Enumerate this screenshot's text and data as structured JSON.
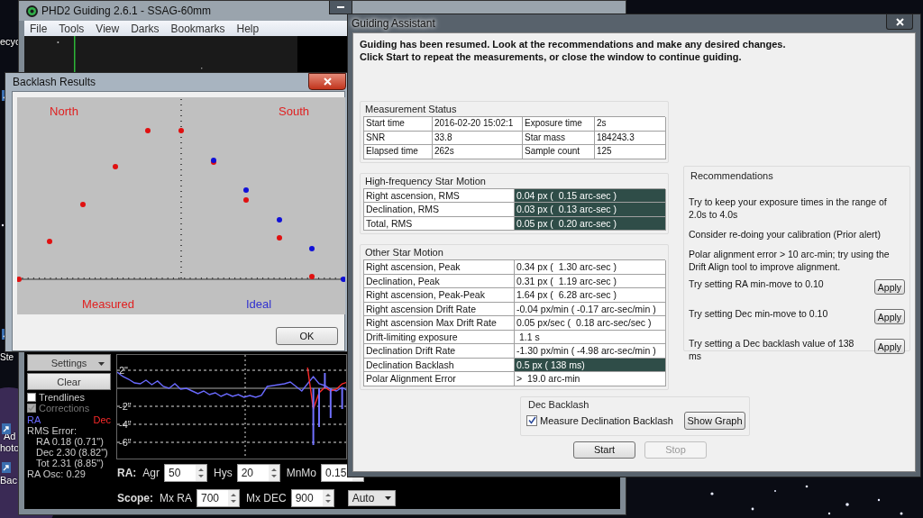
{
  "desktop": {
    "icon_labels": [
      "ecyc",
      "Ste",
      "Ad",
      "hoto",
      "Bac"
    ]
  },
  "main_window": {
    "title": "PHD2 Guiding 2.6.1 - SSAG-60mm",
    "menu": [
      "File",
      "Tools",
      "View",
      "Darks",
      "Bookmarks",
      "Help"
    ],
    "side_buttons": [
      {
        "label": "Settings",
        "kind": "dropdown"
      },
      {
        "label": "Clear",
        "kind": "plain"
      }
    ],
    "checkboxes": [
      {
        "label": "Trendlines",
        "checked": false,
        "disabled": false
      },
      {
        "label": "Corrections",
        "checked": true,
        "disabled": true
      }
    ],
    "stats": [
      {
        "text": "RMS Error:",
        "kind": "heading"
      },
      {
        "text": "RA 0.18 (0.71\")",
        "kind": "indented"
      },
      {
        "text": "Dec 2.30 (8.82\")",
        "kind": "indented"
      },
      {
        "text": "Tot 2.31 (8.85\")",
        "kind": "indented"
      },
      {
        "text": "RA Osc: 0.29",
        "kind": "heading"
      }
    ],
    "chart_data": {
      "type": "line",
      "grid": true,
      "ylim": [
        -8.1,
        3.7
      ],
      "yticks": [
        {
          "value": 2,
          "label": "2\""
        },
        {
          "value": -2,
          "label": "-2\""
        },
        {
          "value": -4,
          "label": "-4\""
        },
        {
          "value": -6,
          "label": "-6\""
        }
      ],
      "series": [
        {
          "name": "RA",
          "color": "#6a6aff",
          "values": [
            1.8,
            1.3,
            1.0,
            0.6,
            0.5,
            0.9,
            0.4,
            0.8,
            0.2,
            0.0,
            0.5,
            -0.1,
            0.0,
            -0.3,
            -0.6,
            -0.3,
            -0.7,
            -0.5,
            -0.9,
            -0.6,
            -0.9,
            -0.7,
            -1.0,
            -0.8,
            -1.0,
            -0.8,
            0.2,
            0.3,
            0.4,
            0.5,
            0.7,
            0.2,
            -0.3,
            0.5,
            1.3,
            0.5,
            0.3,
            -0.1,
            -0.3,
            0.1,
            -0.3
          ]
        },
        {
          "name": "Dec",
          "color": "#ff2a2a",
          "values": [
            null,
            null,
            null,
            null,
            null,
            null,
            null,
            null,
            null,
            null,
            null,
            null,
            null,
            null,
            null,
            null,
            null,
            null,
            null,
            null,
            null,
            null,
            null,
            null,
            null,
            null,
            null,
            null,
            null,
            null,
            null,
            null,
            null,
            2.3,
            -2.3,
            -0.5,
            0.1,
            -0.3,
            -0.1,
            0.5,
            0.7
          ]
        },
        {
          "type": "bar",
          "color": "#7070ff",
          "values": [
            null,
            null,
            null,
            null,
            null,
            null,
            null,
            null,
            null,
            null,
            null,
            null,
            null,
            null,
            null,
            null,
            null,
            null,
            null,
            null,
            null,
            null,
            null,
            null,
            null,
            null,
            null,
            null,
            null,
            null,
            null,
            null,
            null,
            null,
            -6.3,
            -4.3,
            1.7,
            -3.3,
            null,
            -2.3,
            null
          ]
        }
      ]
    },
    "control_rows": [
      {
        "heading": "RA:",
        "fields": [
          {
            "label": "Agr",
            "value": "50"
          },
          {
            "label": "Hys",
            "value": "20"
          },
          {
            "label": "MnMo",
            "value": "0.15"
          }
        ]
      },
      {
        "heading": "Scope:",
        "fields": [
          {
            "label": "Mx RA",
            "value": "700"
          },
          {
            "label": "Mx DEC",
            "value": "900"
          }
        ],
        "dropdown": "Auto"
      }
    ]
  },
  "backlash_window": {
    "title": "Backlash Results",
    "north": "North",
    "south": "South",
    "measured": "Measured",
    "ideal": "Ideal",
    "ok": "OK"
  },
  "assistant": {
    "title": "Guiding Assistant",
    "intro": [
      "Guiding has been resumed. Look at the recommendations and make any desired changes.",
      "Click Start to repeat the measurements, or close the window to continue guiding."
    ],
    "measurement_status": {
      "title": "Measurement Status",
      "rows": [
        [
          "Start time",
          "2016-02-20 15:02:1",
          "Exposure time",
          "2s"
        ],
        [
          "SNR",
          "33.8",
          "Star mass",
          "184243.3"
        ],
        [
          "Elapsed time",
          "262s",
          "Sample count",
          "125"
        ]
      ]
    },
    "high_frequency": {
      "title": "High-frequency Star Motion",
      "rows": [
        {
          "label": "Right ascension, RMS",
          "value": "0.04 px (  0.15 arc-sec )",
          "highlighted": true
        },
        {
          "label": "Declination, RMS",
          "value": "0.03 px (  0.13 arc-sec )",
          "highlighted": true
        },
        {
          "label": "Total, RMS",
          "value": "0.05 px (  0.20 arc-sec )",
          "highlighted": true
        }
      ]
    },
    "other_motion": {
      "title": "Other Star Motion",
      "rows": [
        {
          "label": "Right ascension, Peak",
          "value": "0.34 px (  1.30 arc-sec )",
          "highlighted": false
        },
        {
          "label": "Declination, Peak",
          "value": "0.31 px (  1.19 arc-sec )",
          "highlighted": false
        },
        {
          "label": "Right ascension, Peak-Peak",
          "value": "1.64 px (  6.28 arc-sec )",
          "highlighted": false
        },
        {
          "label": "Right ascension Drift Rate",
          "value": "-0.04 px/min ( -0.17 arc-sec/min )",
          "highlighted": false
        },
        {
          "label": "Right ascension Max Drift Rate",
          "value": "0.05 px/sec (  0.18 arc-sec/sec )",
          "highlighted": false
        },
        {
          "label": "Drift-limiting exposure",
          "value": " 1.1 s",
          "highlighted": false
        },
        {
          "label": "Declination Drift Rate",
          "value": "-1.30 px/min ( -4.98 arc-sec/min )",
          "highlighted": false
        },
        {
          "label": "Declination Backlash",
          "value": "0.5 px ( 138 ms)",
          "highlighted": true
        },
        {
          "label": "Polar Alignment Error",
          "value": ">  19.0 arc-min",
          "highlighted": false
        }
      ]
    },
    "recommendations": {
      "title": "Recommendations",
      "items": [
        {
          "text": "Try to keep your exposure times in the range of 2.0s to 4.0s"
        },
        {
          "text": "Consider re-doing your calibration (Prior alert)"
        },
        {
          "text": "Polar alignment error > 10 arc-min; try using the Drift Align tool to improve alignment."
        },
        {
          "text": "Try setting RA min-move to 0.10",
          "button": "Apply"
        },
        {
          "text": "Try setting Dec min-move to 0.10",
          "button": "Apply"
        },
        {
          "text": "Try setting a Dec backlash value of 138 ms",
          "button": "Apply"
        }
      ]
    },
    "dec_backlash": {
      "title": "Dec Backlash",
      "checkbox": {
        "label": "Measure Declination Backlash",
        "checked": true
      },
      "button": "Show Graph"
    },
    "buttons": [
      {
        "label": "Start",
        "disabled": false
      },
      {
        "label": "Stop",
        "disabled": true
      }
    ]
  }
}
